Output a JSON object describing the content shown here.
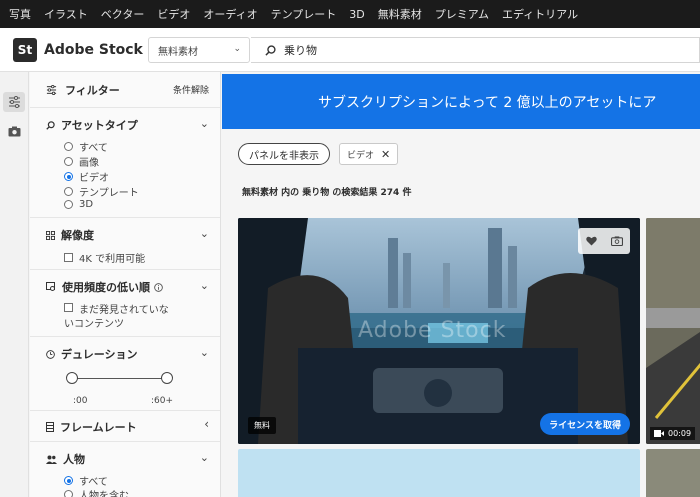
{
  "topnav": {
    "items": [
      "写真",
      "イラスト",
      "ベクター",
      "ビデオ",
      "オーディオ",
      "テンプレート",
      "3D",
      "無料素材",
      "プレミアム",
      "エディトリアル"
    ]
  },
  "header": {
    "logo_badge": "St",
    "logo_text": "Adobe Stock",
    "scope_value": "無料素材",
    "search_value": "乗り物"
  },
  "filters": {
    "title": "フィルター",
    "clear_label": "条件解除",
    "asset_type": {
      "title": "アセットタイプ",
      "options": [
        {
          "label": "すべて",
          "selected": false
        },
        {
          "label": "画像",
          "selected": false
        },
        {
          "label": "ビデオ",
          "selected": true
        },
        {
          "label": "テンプレート",
          "selected": false
        },
        {
          "label": "3D",
          "selected": false
        }
      ]
    },
    "resolution": {
      "title": "解像度",
      "option": "4K で利用可能"
    },
    "usage": {
      "title": "使用頻度の低い順",
      "option_line1": "まだ発見されていな",
      "option_line2": "いコンテンツ"
    },
    "duration": {
      "title": "デュレーション",
      "min_label": ":00",
      "max_label": ":60+"
    },
    "framerate": {
      "title": "フレームレート"
    },
    "people": {
      "title": "人物",
      "options": [
        {
          "label": "すべて",
          "selected": true
        },
        {
          "label": "人物を含む",
          "selected": false
        }
      ]
    }
  },
  "main": {
    "banner_text": "サブスクリプションによって 2 億以上のアセットにア",
    "hide_panel_label": "パネルを非表示",
    "chip_label": "ビデオ",
    "result_text": "無料素材 内の 乗り物 の検索結果 274 件",
    "card1": {
      "free_label": "無料",
      "license_label": "ライセンスを取得",
      "watermark": "Adobe Stock"
    },
    "card2": {
      "duration": "00:09"
    }
  },
  "colors": {
    "accent": "#1473e6",
    "topnav_bg": "#1b1b1b"
  }
}
